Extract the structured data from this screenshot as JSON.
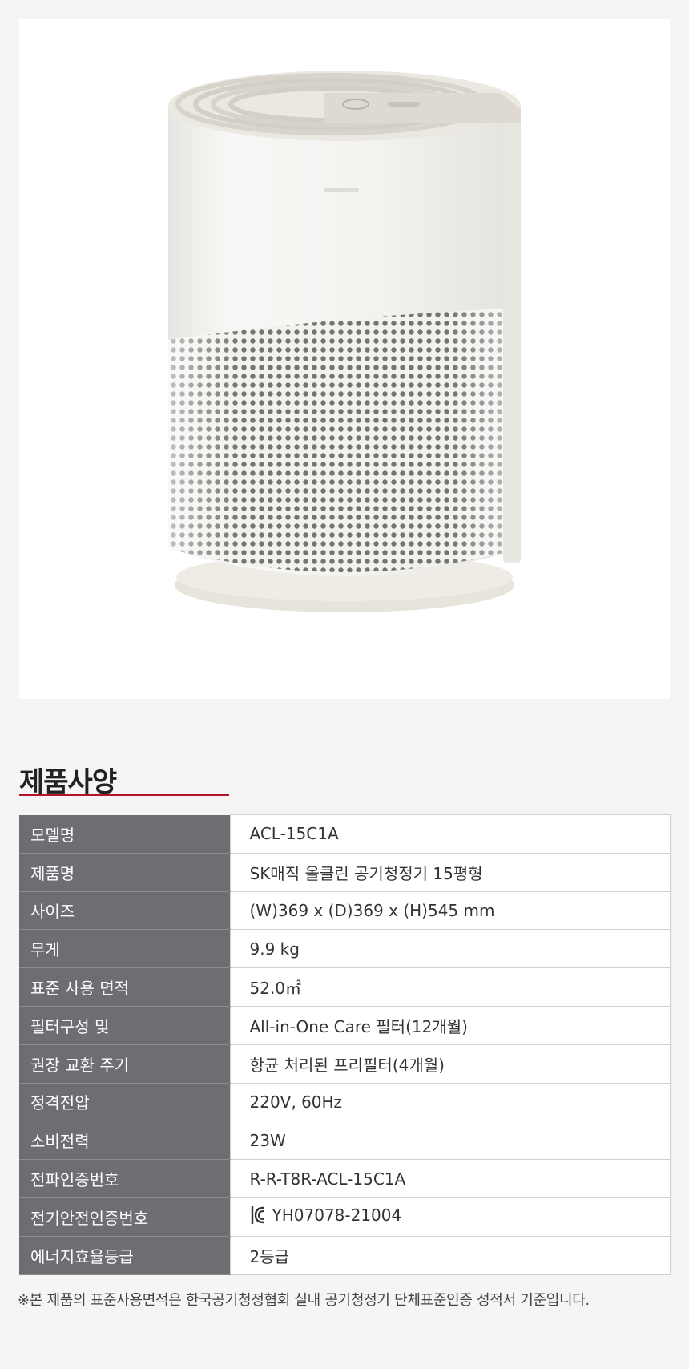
{
  "section_title": "제품사양",
  "accent_color": "#b5122b",
  "spec_rows": [
    {
      "label": "모델명",
      "value": "ACL-15C1A"
    },
    {
      "label": "제품명",
      "value": "SK매직 올클린 공기청정기 15평형"
    },
    {
      "label": "사이즈",
      "value": "(W)369 x (D)369 x (H)545 mm"
    },
    {
      "label": "무게",
      "value": "9.9 kg"
    },
    {
      "label": "표준 사용 면적",
      "value": "52.0㎡"
    },
    {
      "label": "필터구성 및",
      "value": "All-in-One Care 필터(12개월)"
    },
    {
      "label": "권장 교환 주기",
      "value": "항균 처리된 프리필터(4개월)"
    },
    {
      "label": "정격전압",
      "value": "220V, 60Hz"
    },
    {
      "label": "소비전력",
      "value": "23W"
    },
    {
      "label": "전파인증번호",
      "value": "R-R-T8R-ACL-15C1A"
    },
    {
      "label": "전기안전인증번호",
      "value": "YH07078-21004",
      "icon": "kc-certification-icon"
    },
    {
      "label": "에너지효율등급",
      "value": "2등급"
    }
  ],
  "footnote": "※본 제품의 표준사용면적은 한국공기청정협회 실내 공기청정기 단체표준인증 성적서 기준입니다."
}
